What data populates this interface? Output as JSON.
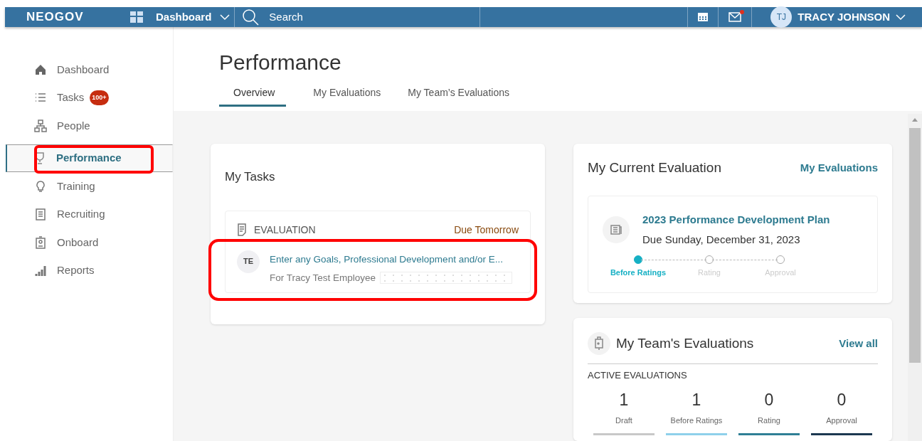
{
  "topbar": {
    "logo": "NEOGOV",
    "module": "Dashboard",
    "search": {
      "placeholder": "Search"
    },
    "notifications": true,
    "user": {
      "initials": "TJ",
      "name": "TRACY JOHNSON"
    }
  },
  "sidebar": {
    "items": [
      {
        "label": "Dashboard",
        "selected": false,
        "highlighted": false
      },
      {
        "label": "Tasks",
        "badge": "100+",
        "selected": false,
        "highlighted": false
      },
      {
        "label": "People",
        "selected": false,
        "highlighted": false
      },
      {
        "label": "Performance",
        "selected": true,
        "highlighted": true
      },
      {
        "label": "Training",
        "selected": false,
        "highlighted": false
      },
      {
        "label": "Recruiting",
        "selected": false,
        "highlighted": false
      },
      {
        "label": "Onboard",
        "selected": false,
        "highlighted": false
      },
      {
        "label": "Reports",
        "selected": false,
        "highlighted": false
      }
    ]
  },
  "page": {
    "title": "Performance",
    "tabs": [
      {
        "label": "Overview",
        "selected": true
      },
      {
        "label": "My Evaluations",
        "selected": false
      },
      {
        "label": "My Team’s Evaluations",
        "selected": false
      }
    ]
  },
  "my_tasks": {
    "title": "My Tasks",
    "group": {
      "type": "EVALUATION",
      "due": "Due Tomorrow",
      "tasks": [
        {
          "initials": "TE",
          "title": "Enter any Goals, Professional Development and/or E...",
          "subtitle": "For Tracy Test Employee",
          "highlighted": true
        }
      ]
    }
  },
  "current_evaluation": {
    "title": "My Current Evaluation",
    "link": "My Evaluations",
    "plan": {
      "title": "2023 Performance Development Plan",
      "due": "Due Sunday, December 31, 2023",
      "steps": [
        {
          "label": "Before Ratings",
          "selected": true
        },
        {
          "label": "Rating",
          "selected": false
        },
        {
          "label": "Approval",
          "selected": false
        }
      ]
    }
  },
  "team_evaluations": {
    "title": "My Team's Evaluations",
    "link": "View all",
    "section": "ACTIVE EVALUATIONS",
    "stats": [
      {
        "value": "1",
        "label": "Draft",
        "color": "#c8c8c8"
      },
      {
        "value": "1",
        "label": "Before Ratings",
        "color": "#8fd0ea"
      },
      {
        "value": "0",
        "label": "Rating",
        "color": "#2f7f95"
      },
      {
        "value": "0",
        "label": "Approval",
        "color": "#1c3850"
      }
    ]
  }
}
